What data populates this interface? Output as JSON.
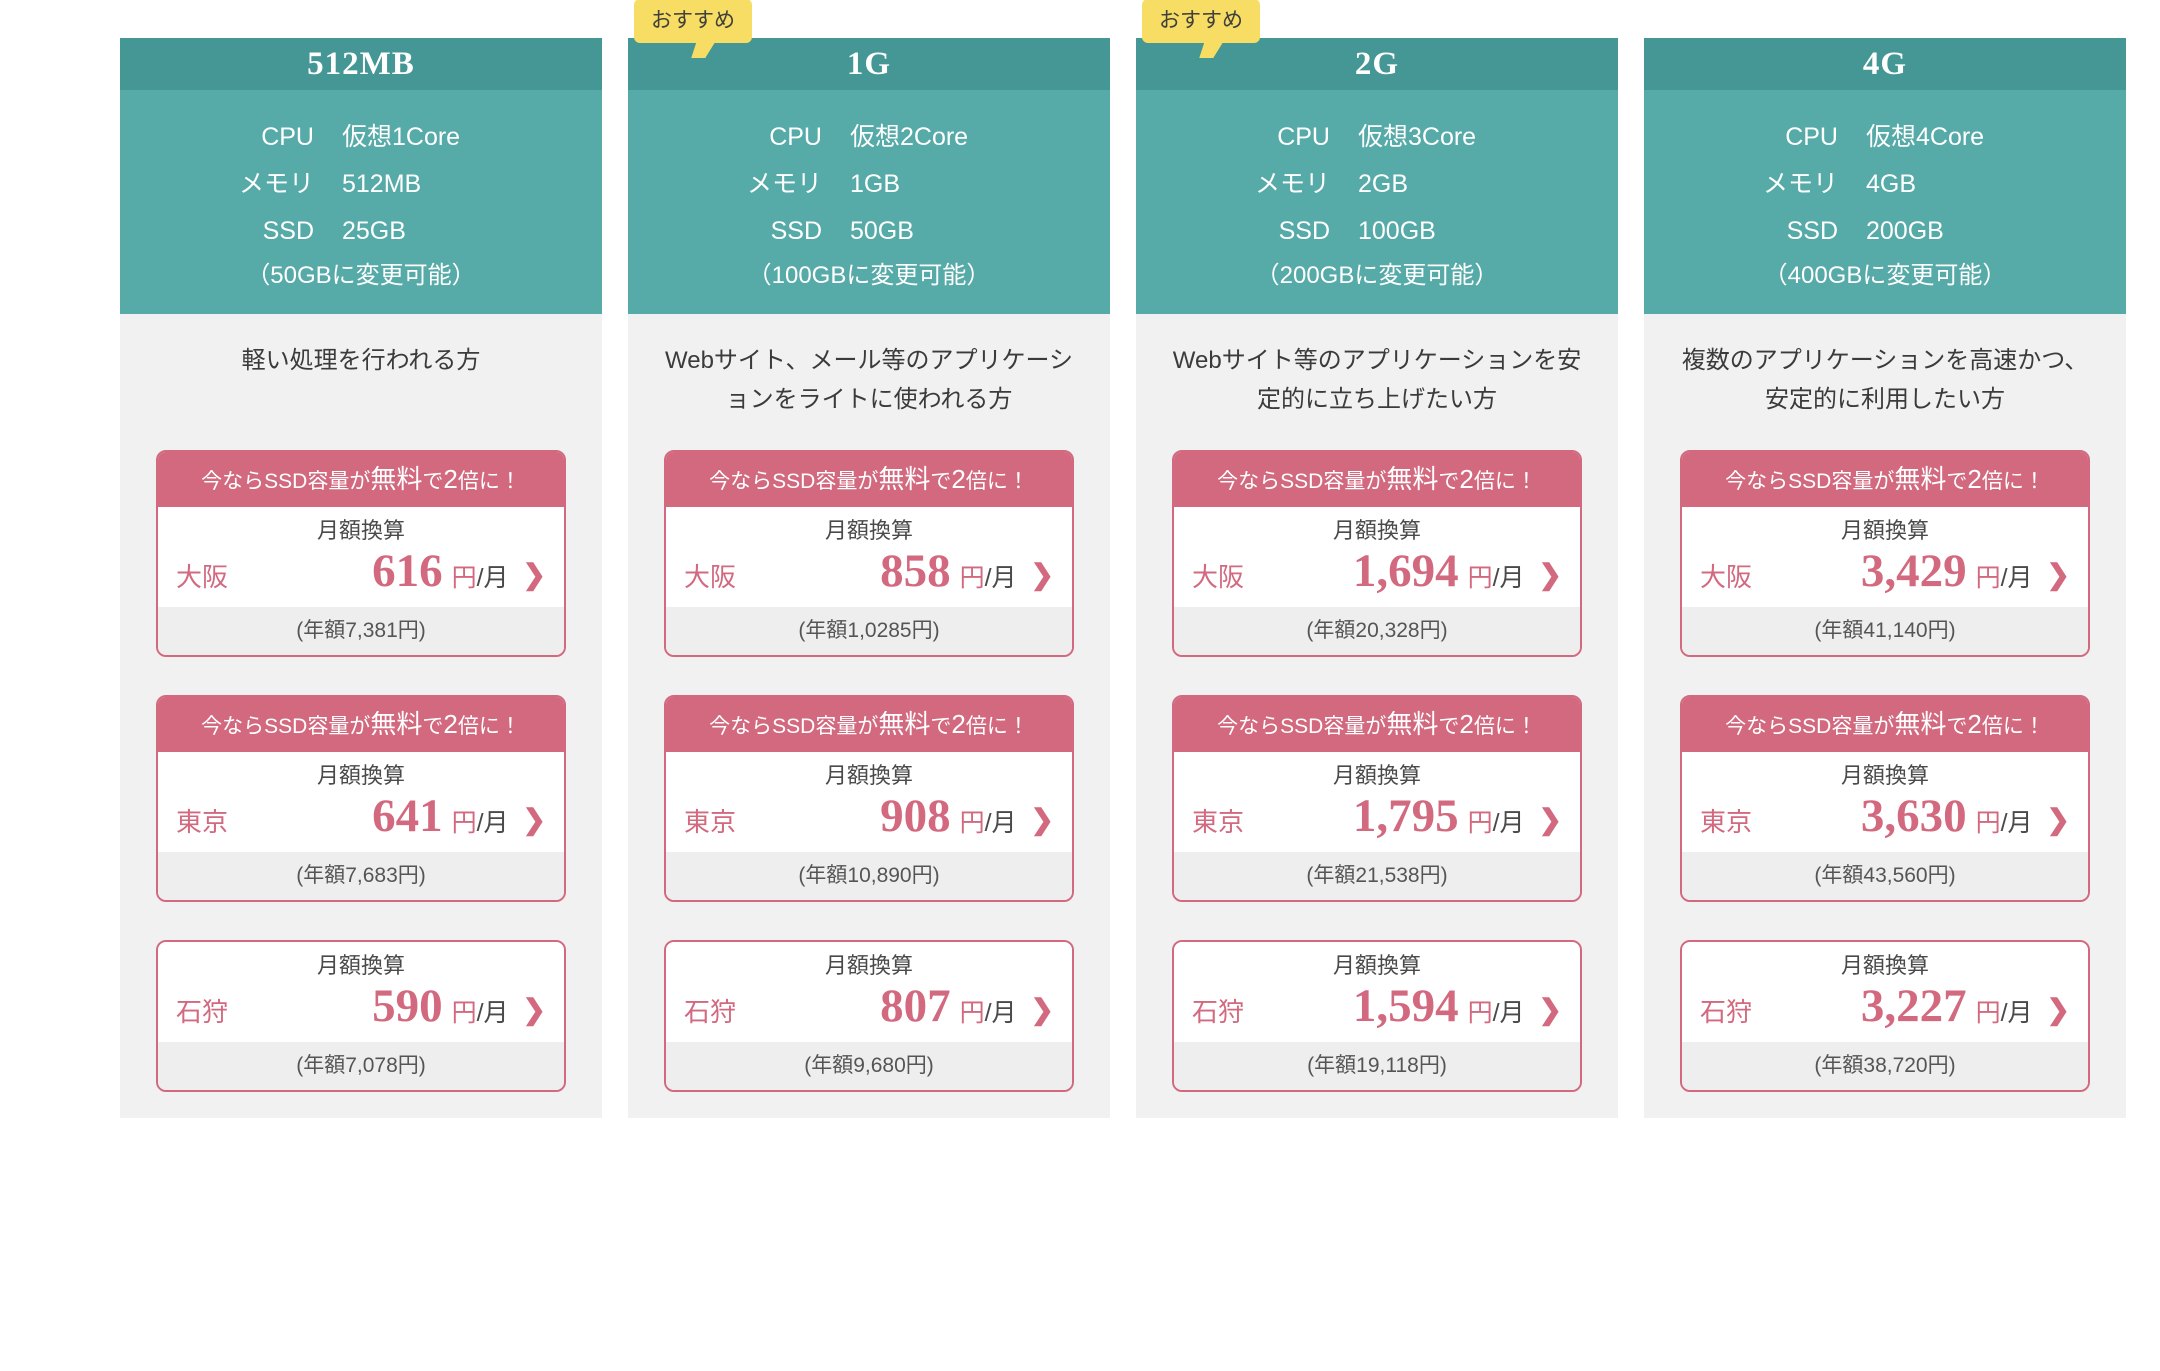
{
  "common": {
    "recommend_badge": "おすすめ",
    "spec_labels": {
      "cpu": "CPU",
      "memory": "メモリ",
      "ssd": "SSD"
    },
    "campaign_text_pre": "今ならSSD容量が",
    "campaign_text_big": "無料",
    "campaign_text_mid": "で",
    "campaign_text_big2": "2",
    "campaign_text_post": "倍に！",
    "monthly_label": "月額換算",
    "yen_unit": "円",
    "per_month": "/月",
    "chevron_icon": "❯",
    "colors": {
      "header_dark_teal": "#449795",
      "header_light_teal": "#56aaa7",
      "badge_yellow": "#f7dd63",
      "accent_pink": "#d2697f",
      "column_bg": "#f1f1f1",
      "card_foot_bg": "#eeeeee"
    }
  },
  "plans": [
    {
      "id": "512mb",
      "title": "512MB",
      "recommended": false,
      "specs": {
        "cpu": "仮想1Core",
        "memory": "512MB",
        "ssd": "25GB",
        "note": "（50GBに変更可能）"
      },
      "description": "軽い処理を行われる方",
      "prices": [
        {
          "region": "大阪",
          "amount": "616",
          "annual": "(年額7,381円)",
          "campaign": true
        },
        {
          "region": "東京",
          "amount": "641",
          "annual": "(年額7,683円)",
          "campaign": true
        },
        {
          "region": "石狩",
          "amount": "590",
          "annual": "(年額7,078円)",
          "campaign": false
        }
      ]
    },
    {
      "id": "1g",
      "title": "1G",
      "recommended": true,
      "specs": {
        "cpu": "仮想2Core",
        "memory": "1GB",
        "ssd": "50GB",
        "note": "（100GBに変更可能）"
      },
      "description": "Webサイト、メール等のアプリケーションをライトに使われる方",
      "prices": [
        {
          "region": "大阪",
          "amount": "858",
          "annual": "(年額1,0285円)",
          "campaign": true
        },
        {
          "region": "東京",
          "amount": "908",
          "annual": "(年額10,890円)",
          "campaign": true
        },
        {
          "region": "石狩",
          "amount": "807",
          "annual": "(年額9,680円)",
          "campaign": false
        }
      ]
    },
    {
      "id": "2g",
      "title": "2G",
      "recommended": true,
      "specs": {
        "cpu": "仮想3Core",
        "memory": "2GB",
        "ssd": "100GB",
        "note": "（200GBに変更可能）"
      },
      "description": "Webサイト等のアプリケーションを安定的に立ち上げたい方",
      "prices": [
        {
          "region": "大阪",
          "amount": "1,694",
          "annual": "(年額20,328円)",
          "campaign": true
        },
        {
          "region": "東京",
          "amount": "1,795",
          "annual": "(年額21,538円)",
          "campaign": true
        },
        {
          "region": "石狩",
          "amount": "1,594",
          "annual": "(年額19,118円)",
          "campaign": false
        }
      ]
    },
    {
      "id": "4g",
      "title": "4G",
      "recommended": false,
      "specs": {
        "cpu": "仮想4Core",
        "memory": "4GB",
        "ssd": "200GB",
        "note": "（400GBに変更可能）"
      },
      "description": "複数のアプリケーションを高速かつ、安定的に利用したい方",
      "prices": [
        {
          "region": "大阪",
          "amount": "3,429",
          "annual": "(年額41,140円)",
          "campaign": true
        },
        {
          "region": "東京",
          "amount": "3,630",
          "annual": "(年額43,560円)",
          "campaign": true
        },
        {
          "region": "石狩",
          "amount": "3,227",
          "annual": "(年額38,720円)",
          "campaign": false
        }
      ]
    }
  ]
}
